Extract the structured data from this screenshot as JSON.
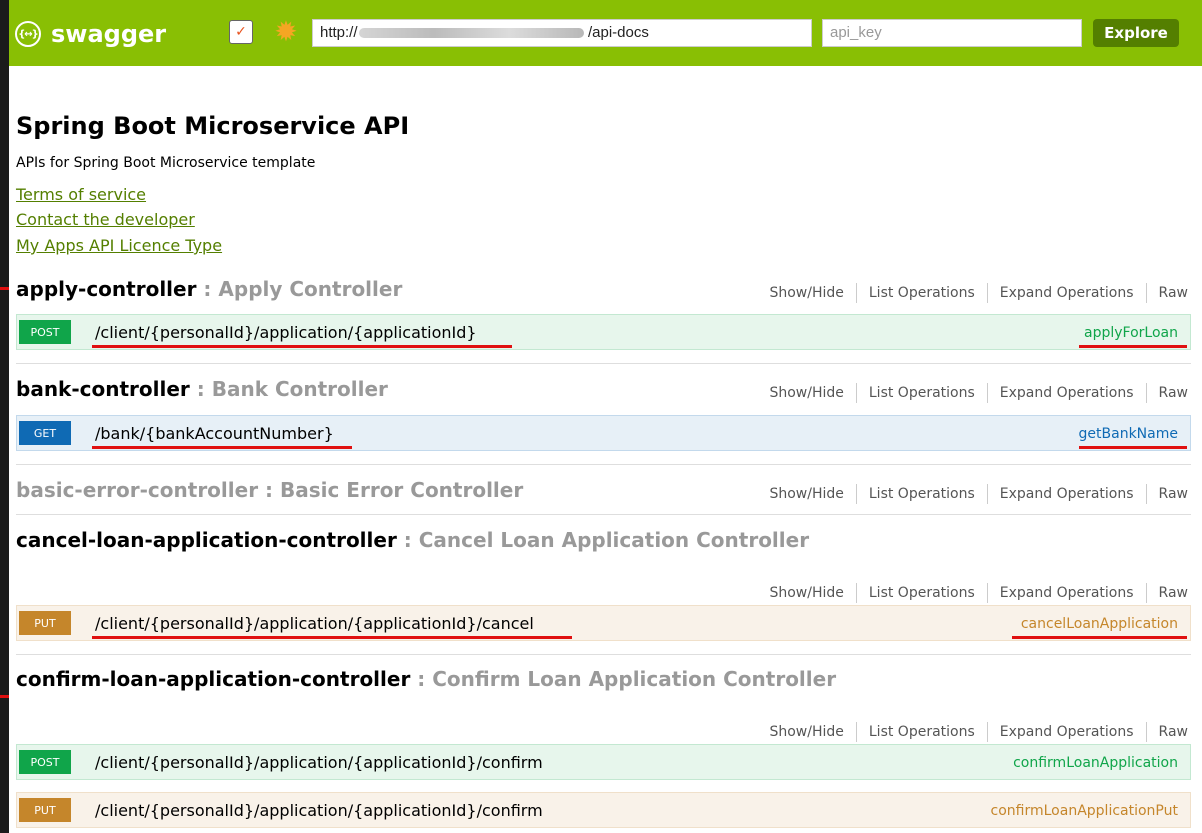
{
  "header": {
    "logo_symbol": "{↔}",
    "logo_text": "swagger",
    "url_prefix": "http://",
    "url_suffix": "/api-docs",
    "api_key_placeholder": "api_key",
    "explore_label": "Explore",
    "accent_color": "#89bf04"
  },
  "info": {
    "title": "Spring Boot Microservice API",
    "description": "APIs for Spring Boot Microservice template",
    "links": [
      "Terms of service",
      "Contact the developer",
      "My Apps API Licence Type"
    ]
  },
  "actions": [
    "Show/Hide",
    "List Operations",
    "Expand Operations",
    "Raw"
  ],
  "controllers": [
    {
      "name": "apply-controller",
      "description": " : Apply Controller"
    },
    {
      "name": "bank-controller",
      "description": " : Bank Controller"
    },
    {
      "name": "basic-error-controller",
      "description": " : Basic Error Controller"
    },
    {
      "name": "cancel-loan-application-controller",
      "description": " : Cancel Loan Application Controller"
    },
    {
      "name": "confirm-loan-application-controller",
      "description": " : Confirm Loan Application Controller"
    }
  ],
  "operations": [
    {
      "method": "POST",
      "path": "/client/{personalId}/application/{applicationId}",
      "operation_id": "applyForLoan"
    },
    {
      "method": "GET",
      "path": "/bank/{bankAccountNumber}",
      "operation_id": "getBankName"
    },
    {
      "method": "PUT",
      "path": "/client/{personalId}/application/{applicationId}/cancel",
      "operation_id": "cancelLoanApplication"
    },
    {
      "method": "POST",
      "path": "/client/{personalId}/application/{applicationId}/confirm",
      "operation_id": "confirmLoanApplication"
    },
    {
      "method": "PUT",
      "path": "/client/{personalId}/application/{applicationId}/confirm",
      "operation_id": "confirmLoanApplicationPut"
    }
  ],
  "colors": {
    "post": "#10a54a",
    "get": "#0f6ab4",
    "put": "#c5862b",
    "annotation": "#e01010"
  }
}
